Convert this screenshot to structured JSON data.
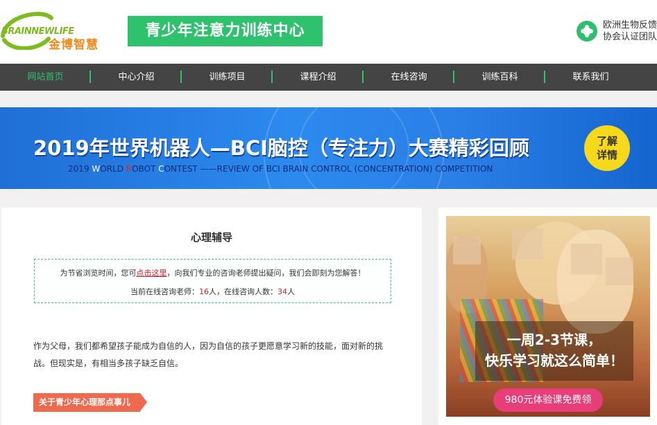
{
  "header": {
    "logo_en": "BRAINNEWLIFE",
    "logo_cn": "金博智慧",
    "title": "青少年注意力训练中心",
    "cert_line1": "欧洲生物反馈",
    "cert_line2": "协会认证团队"
  },
  "nav": {
    "items": [
      {
        "label": "网站首页",
        "active": true
      },
      {
        "label": "中心介绍"
      },
      {
        "label": "训练项目"
      },
      {
        "label": "课程介绍"
      },
      {
        "label": "在线咨询"
      },
      {
        "label": "训练百科"
      },
      {
        "label": "联系我们"
      }
    ]
  },
  "banner": {
    "title": "2019年世界机器人—BCI脑控（专注力）大赛精彩回顾",
    "sub_prefix": "2019 ",
    "sub_w": "W",
    "sub_orld": "ORLD ",
    "sub_r": "R",
    "sub_obot": "OBOT ",
    "sub_c": "C",
    "sub_rest": "ONTEST ——REVIEW OF BCI BRAIN CONTROL (CONCENTRATION) COMPETITION",
    "detail_line1": "了解",
    "detail_line2": "详情"
  },
  "main": {
    "title": "心理辅导",
    "notice_before": "为节省浏览时间，您可",
    "notice_link": "点击这里",
    "notice_after": "，向我们专业的咨询老师提出疑问，我们会即刻为您解答！",
    "online_prefix": "当前在线咨询老师：",
    "online_teachers": "16",
    "online_mid": "人，在线咨询人数：",
    "online_users": "34",
    "online_suffix": "人",
    "paragraph": "作为父母，我们都希望孩子能成为自信的人，因为自信的孩子更愿意学习新的技能，面对新的挑战。但现实是，有相当多孩子缺乏自信。",
    "tag": "关于青少年心理那点事儿"
  },
  "ad": {
    "line1": "一周2-3节课，",
    "line2": "快乐学习就这么简单！",
    "button": "980元体验课免费领"
  }
}
